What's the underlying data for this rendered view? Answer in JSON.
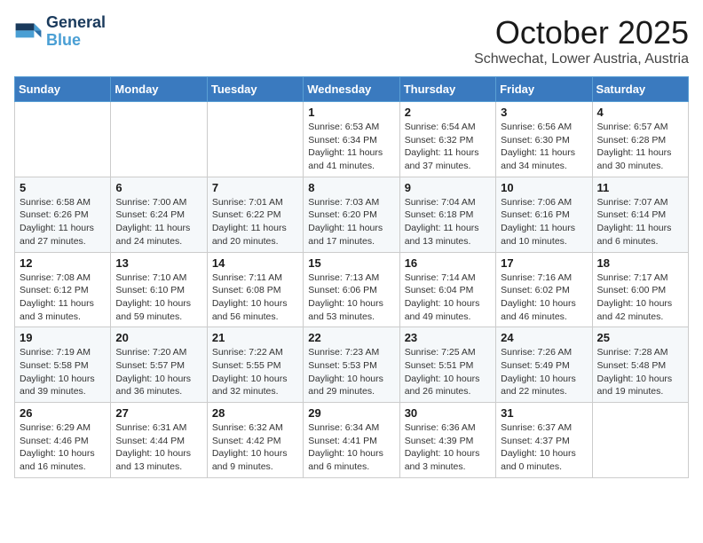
{
  "header": {
    "logo_line1": "General",
    "logo_line2": "Blue",
    "month": "October 2025",
    "location": "Schwechat, Lower Austria, Austria"
  },
  "weekdays": [
    "Sunday",
    "Monday",
    "Tuesday",
    "Wednesday",
    "Thursday",
    "Friday",
    "Saturday"
  ],
  "weeks": [
    [
      {
        "day": "",
        "info": ""
      },
      {
        "day": "",
        "info": ""
      },
      {
        "day": "",
        "info": ""
      },
      {
        "day": "1",
        "info": "Sunrise: 6:53 AM\nSunset: 6:34 PM\nDaylight: 11 hours\nand 41 minutes."
      },
      {
        "day": "2",
        "info": "Sunrise: 6:54 AM\nSunset: 6:32 PM\nDaylight: 11 hours\nand 37 minutes."
      },
      {
        "day": "3",
        "info": "Sunrise: 6:56 AM\nSunset: 6:30 PM\nDaylight: 11 hours\nand 34 minutes."
      },
      {
        "day": "4",
        "info": "Sunrise: 6:57 AM\nSunset: 6:28 PM\nDaylight: 11 hours\nand 30 minutes."
      }
    ],
    [
      {
        "day": "5",
        "info": "Sunrise: 6:58 AM\nSunset: 6:26 PM\nDaylight: 11 hours\nand 27 minutes."
      },
      {
        "day": "6",
        "info": "Sunrise: 7:00 AM\nSunset: 6:24 PM\nDaylight: 11 hours\nand 24 minutes."
      },
      {
        "day": "7",
        "info": "Sunrise: 7:01 AM\nSunset: 6:22 PM\nDaylight: 11 hours\nand 20 minutes."
      },
      {
        "day": "8",
        "info": "Sunrise: 7:03 AM\nSunset: 6:20 PM\nDaylight: 11 hours\nand 17 minutes."
      },
      {
        "day": "9",
        "info": "Sunrise: 7:04 AM\nSunset: 6:18 PM\nDaylight: 11 hours\nand 13 minutes."
      },
      {
        "day": "10",
        "info": "Sunrise: 7:06 AM\nSunset: 6:16 PM\nDaylight: 11 hours\nand 10 minutes."
      },
      {
        "day": "11",
        "info": "Sunrise: 7:07 AM\nSunset: 6:14 PM\nDaylight: 11 hours\nand 6 minutes."
      }
    ],
    [
      {
        "day": "12",
        "info": "Sunrise: 7:08 AM\nSunset: 6:12 PM\nDaylight: 11 hours\nand 3 minutes."
      },
      {
        "day": "13",
        "info": "Sunrise: 7:10 AM\nSunset: 6:10 PM\nDaylight: 10 hours\nand 59 minutes."
      },
      {
        "day": "14",
        "info": "Sunrise: 7:11 AM\nSunset: 6:08 PM\nDaylight: 10 hours\nand 56 minutes."
      },
      {
        "day": "15",
        "info": "Sunrise: 7:13 AM\nSunset: 6:06 PM\nDaylight: 10 hours\nand 53 minutes."
      },
      {
        "day": "16",
        "info": "Sunrise: 7:14 AM\nSunset: 6:04 PM\nDaylight: 10 hours\nand 49 minutes."
      },
      {
        "day": "17",
        "info": "Sunrise: 7:16 AM\nSunset: 6:02 PM\nDaylight: 10 hours\nand 46 minutes."
      },
      {
        "day": "18",
        "info": "Sunrise: 7:17 AM\nSunset: 6:00 PM\nDaylight: 10 hours\nand 42 minutes."
      }
    ],
    [
      {
        "day": "19",
        "info": "Sunrise: 7:19 AM\nSunset: 5:58 PM\nDaylight: 10 hours\nand 39 minutes."
      },
      {
        "day": "20",
        "info": "Sunrise: 7:20 AM\nSunset: 5:57 PM\nDaylight: 10 hours\nand 36 minutes."
      },
      {
        "day": "21",
        "info": "Sunrise: 7:22 AM\nSunset: 5:55 PM\nDaylight: 10 hours\nand 32 minutes."
      },
      {
        "day": "22",
        "info": "Sunrise: 7:23 AM\nSunset: 5:53 PM\nDaylight: 10 hours\nand 29 minutes."
      },
      {
        "day": "23",
        "info": "Sunrise: 7:25 AM\nSunset: 5:51 PM\nDaylight: 10 hours\nand 26 minutes."
      },
      {
        "day": "24",
        "info": "Sunrise: 7:26 AM\nSunset: 5:49 PM\nDaylight: 10 hours\nand 22 minutes."
      },
      {
        "day": "25",
        "info": "Sunrise: 7:28 AM\nSunset: 5:48 PM\nDaylight: 10 hours\nand 19 minutes."
      }
    ],
    [
      {
        "day": "26",
        "info": "Sunrise: 6:29 AM\nSunset: 4:46 PM\nDaylight: 10 hours\nand 16 minutes."
      },
      {
        "day": "27",
        "info": "Sunrise: 6:31 AM\nSunset: 4:44 PM\nDaylight: 10 hours\nand 13 minutes."
      },
      {
        "day": "28",
        "info": "Sunrise: 6:32 AM\nSunset: 4:42 PM\nDaylight: 10 hours\nand 9 minutes."
      },
      {
        "day": "29",
        "info": "Sunrise: 6:34 AM\nSunset: 4:41 PM\nDaylight: 10 hours\nand 6 minutes."
      },
      {
        "day": "30",
        "info": "Sunrise: 6:36 AM\nSunset: 4:39 PM\nDaylight: 10 hours\nand 3 minutes."
      },
      {
        "day": "31",
        "info": "Sunrise: 6:37 AM\nSunset: 4:37 PM\nDaylight: 10 hours\nand 0 minutes."
      },
      {
        "day": "",
        "info": ""
      }
    ]
  ]
}
